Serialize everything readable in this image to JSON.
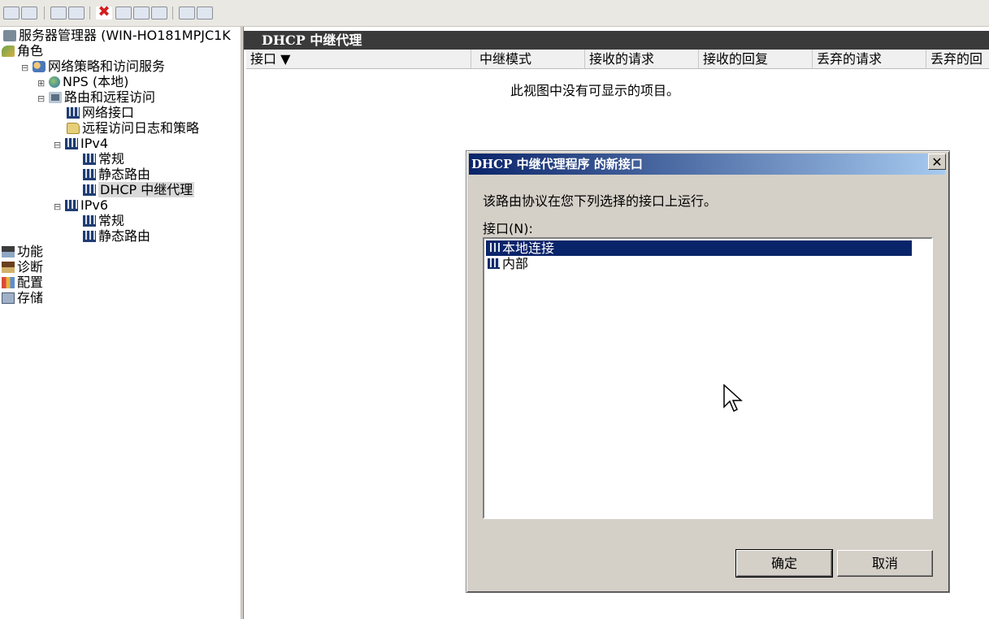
{
  "tree": {
    "root": "服务器管理器 (WIN-HO181MPJC1K",
    "roles": "角色",
    "nps_service": "网络策略和访问服务",
    "nps_local": "NPS (本地)",
    "rras": "路由和远程访问",
    "net_interfaces": "网络接口",
    "remote_log": "远程访问日志和策略",
    "ipv4": "IPv4",
    "ipv4_general": "常规",
    "ipv4_static": "静态路由",
    "ipv4_dhcp": "DHCP 中继代理",
    "ipv6": "IPv6",
    "ipv6_general": "常规",
    "ipv6_static": "静态路由",
    "features": "功能",
    "diagnostics": "诊断",
    "configuration": "配置",
    "storage": "存储"
  },
  "pane": {
    "title": "DHCP 中继代理",
    "columns": [
      "接口 ▼",
      "中继模式",
      "接收的请求",
      "接收的回复",
      "丢弃的请求",
      "丢弃的回"
    ],
    "empty_message": "此视图中没有可显示的项目。"
  },
  "dialog": {
    "title": "DHCP 中继代理程序 的新接口",
    "close": "✕",
    "description": "该路由协议在您下列选择的接口上运行。",
    "list_label": "接口(N):",
    "items": [
      "本地连接",
      "内部"
    ],
    "selected_index": 0,
    "ok_label": "确定",
    "cancel_label": "取消"
  }
}
